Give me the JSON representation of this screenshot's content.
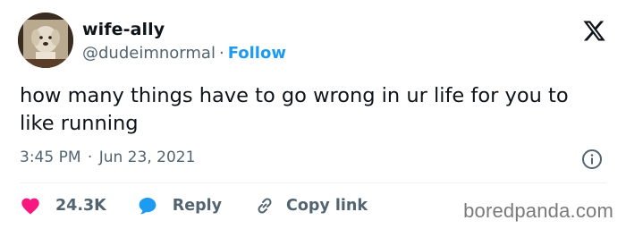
{
  "author": {
    "display_name": "wife-ally",
    "handle": "@dudeimnormal",
    "separator": "·",
    "follow_label": "Follow"
  },
  "tweet": {
    "text": "how many things have to go wrong in ur life for you to like running",
    "time": "3:45 PM",
    "separator": "·",
    "date": "Jun 23, 2021"
  },
  "actions": {
    "likes": "24.3K",
    "reply_label": "Reply",
    "copy_link_label": "Copy link"
  },
  "watermark": "boredpanda.com",
  "colors": {
    "accent": "#1d9bf0",
    "like": "#f91880",
    "text": "#0f1419",
    "secondary": "#536471"
  },
  "icons": {
    "brand": "x-logo-icon",
    "info": "info-icon",
    "like": "heart-icon",
    "reply": "speech-bubble-icon",
    "copy_link": "link-icon"
  }
}
